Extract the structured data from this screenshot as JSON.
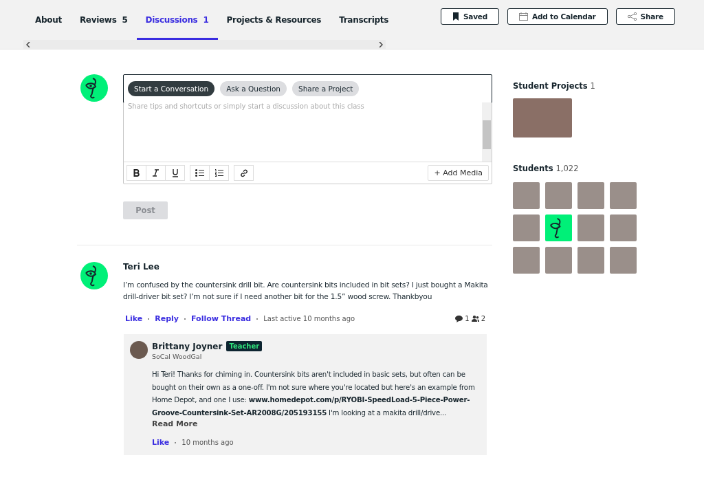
{
  "tabs": [
    {
      "label": "About",
      "selected": false
    },
    {
      "label": "Reviews",
      "count": "5",
      "selected": false
    },
    {
      "label": "Discussions",
      "count": "1",
      "selected": true
    },
    {
      "label": "Projects & Resources",
      "selected": false
    },
    {
      "label": "Transcripts",
      "selected": false
    }
  ],
  "header_buttons": [
    {
      "kind": "bookmark",
      "label": "Saved"
    },
    {
      "kind": "calendar",
      "label": "Add to Calendar"
    },
    {
      "kind": "share",
      "label": "Share"
    }
  ],
  "composer": {
    "types": [
      {
        "label": "Start a Conversation",
        "selected": true
      },
      {
        "label": "Ask a Question",
        "selected": false
      },
      {
        "label": "Share a Project",
        "selected": false
      }
    ],
    "placeholder": "Share tips and shortcuts or simply start a discussion about this class",
    "format_buttons": [
      {
        "kind": "bold"
      },
      {
        "kind": "italic"
      },
      {
        "kind": "underline"
      },
      {
        "kind": "bullets"
      },
      {
        "kind": "numbers"
      },
      {
        "kind": "link"
      }
    ],
    "add_media": "+ Add Media",
    "post": "Post",
    "post_disabled": true
  },
  "thread": {
    "author": "Teri Lee",
    "body": "I’m confused by the countersink drill bit. Are countersink bits included in bit sets? I just bought a Makita drill-driver bit set? I’m not sure if I need another bit for the 1.5” wood screw. Thankbyou",
    "actions": [
      "Like",
      "Reply",
      "Follow Thread"
    ],
    "last_active": "Last active 10 months ago",
    "replies": "1",
    "participants": "2",
    "reply": {
      "author": "Brittany Joyner",
      "badge": "Teacher",
      "subtitle": "SoCal WoodGal",
      "body": "Hi Teri! Thanks for chiming in. Countersink bits aren't included in basic sets, but often can be bought on their own as a one-off. I'm not sure where you're located but here's an example from Home Depot, and one I use: **www.homedepot.com/p/RYOBI-SpeedLoad-5-Piece-Power-Groove-Countersink-Set-AR2008G/205193155** I'm looking at a makita drill/drive...",
      "read_more": "Read More",
      "action": "Like",
      "time": "10 months ago"
    }
  },
  "sidebar": {
    "projects_title": "Student Projects",
    "projects_count": "1",
    "students_title": "Students",
    "students_count": "1,022",
    "students": [
      {
        "kind": "photo"
      },
      {
        "kind": "photo"
      },
      {
        "kind": "photo"
      },
      {
        "kind": "photo"
      },
      {
        "kind": "photo"
      },
      {
        "kind": "drawing"
      },
      {
        "kind": "photo"
      },
      {
        "kind": "photo"
      },
      {
        "kind": "photo"
      },
      {
        "kind": "photo"
      },
      {
        "kind": "photo"
      },
      {
        "kind": "photo"
      }
    ]
  }
}
